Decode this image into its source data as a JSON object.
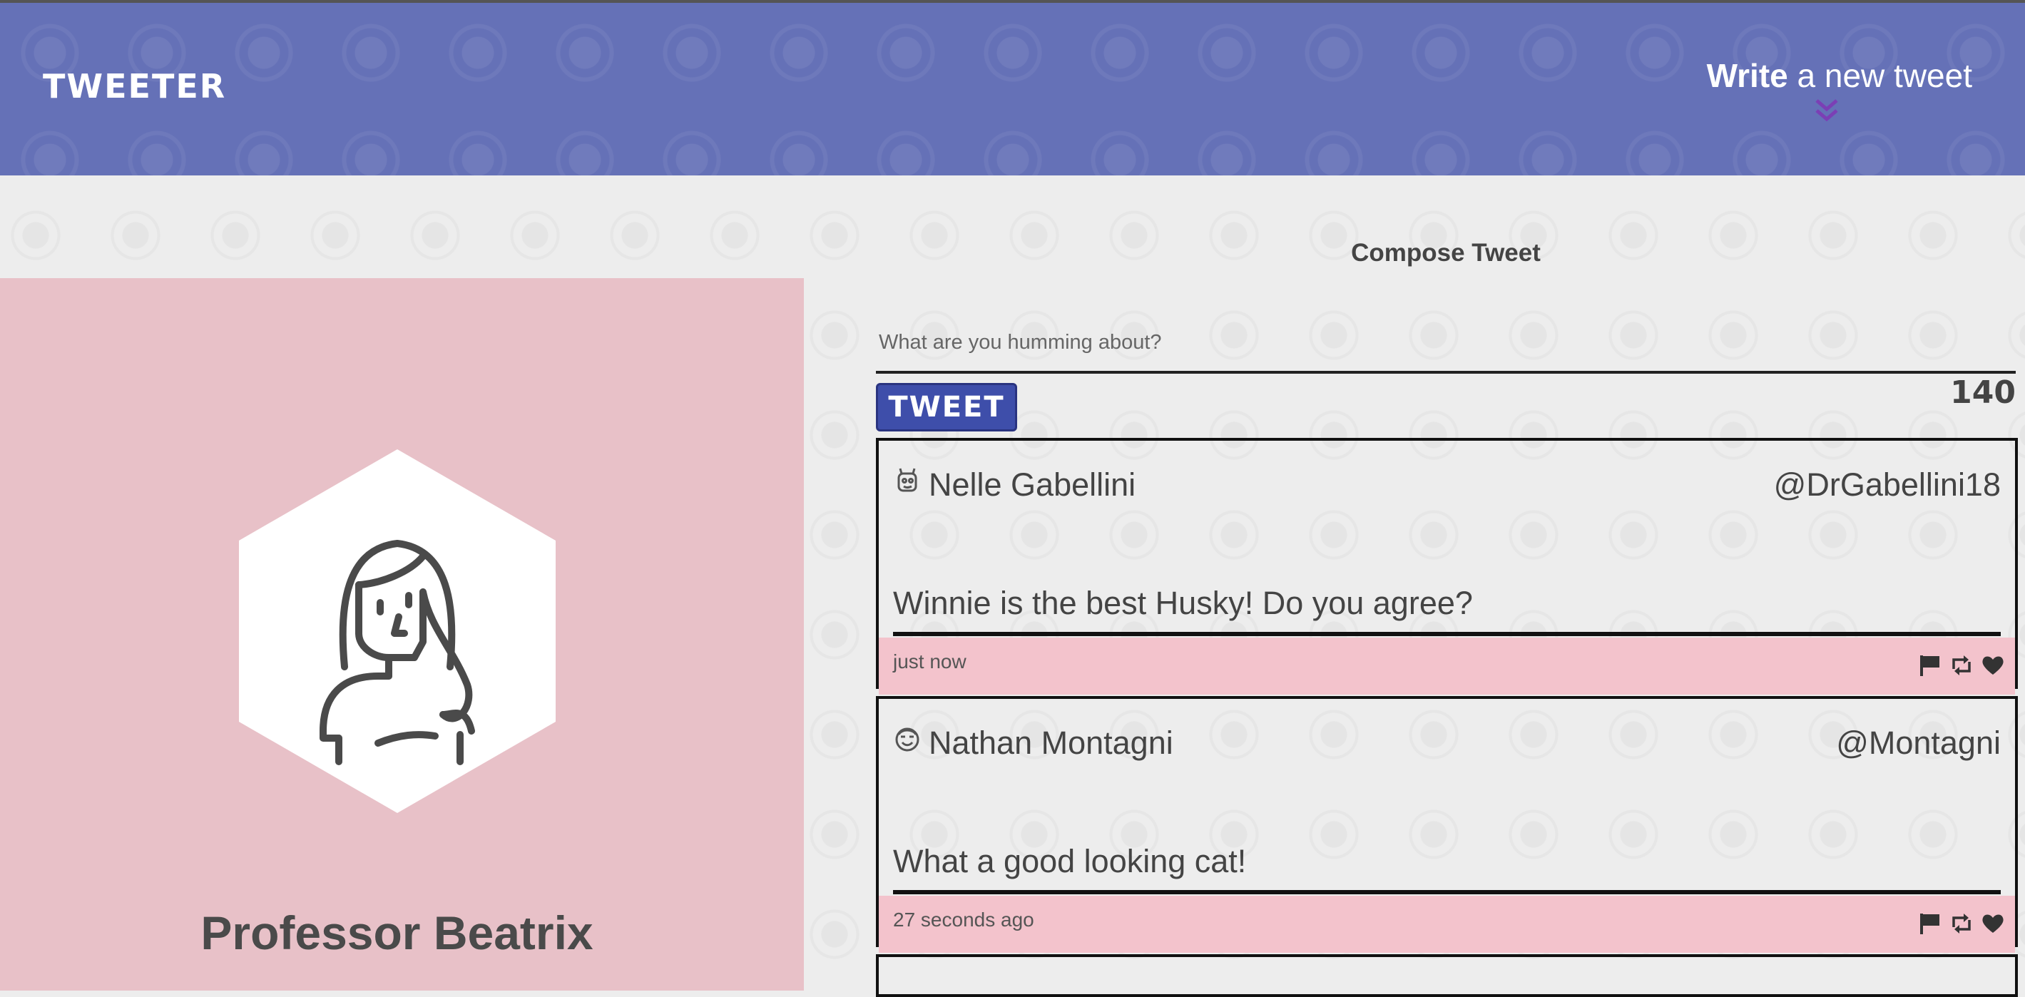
{
  "nav": {
    "brand": "TWEETER",
    "write_bold": "Write",
    "write_rest": " a new tweet"
  },
  "profile": {
    "name": "Professor Beatrix"
  },
  "compose": {
    "title": "Compose Tweet",
    "placeholder": "What are you humming about?",
    "button_label": "TWEET",
    "counter": "140"
  },
  "tweets": [
    {
      "icon": "robot-face-icon",
      "name": "Nelle Gabellini",
      "handle": "@DrGabellini18",
      "text": "Winnie is the best Husky! Do you agree?",
      "time": "just now"
    },
    {
      "icon": "smiley-face-icon",
      "name": "Nathan Montagni",
      "handle": "@Montagni",
      "text": "What a good looking cat!",
      "time": "27 seconds ago"
    }
  ],
  "colors": {
    "nav_bg": "#6571b7",
    "profile_bg": "#e8c1c8",
    "footer_bg": "#f3c3cc",
    "button_bg": "#3e4eaa"
  }
}
